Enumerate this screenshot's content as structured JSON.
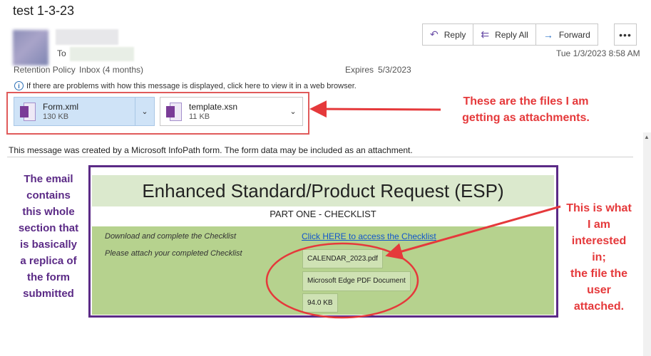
{
  "email": {
    "subject": "test 1-3-23",
    "to_label": "To",
    "retention_policy_label": "Retention Policy",
    "retention_value": "Inbox (4 months)",
    "expires_label": "Expires",
    "expires_value": "5/3/2023",
    "date": "Tue 1/3/2023 8:58 AM",
    "info_bar": "If there are problems with how this message is displayed, click here to view it in a web browser.",
    "infopath_message": "This message was created by a Microsoft InfoPath form. The form data may be included as an attachment."
  },
  "actions": {
    "reply": "Reply",
    "reply_all": "Reply All",
    "forward": "Forward",
    "more": "•••"
  },
  "attachments": [
    {
      "name": "Form.xml",
      "size": "130 KB"
    },
    {
      "name": "template.xsn",
      "size": "11 KB"
    }
  ],
  "form": {
    "title": "Enhanced Standard/Product Request (ESP)",
    "part": "PART ONE - CHECKLIST",
    "download_label": "Download and complete the Checklist",
    "link_text": "Click HERE to access the Checklist",
    "attach_label": "Please attach your completed Checklist",
    "file_name": "CALENDAR_2023.pdf",
    "file_type": "Microsoft Edge PDF Document",
    "file_size": "94.0 KB"
  },
  "annotations": {
    "files_line1": "These are the files I am",
    "files_line2": "getting as attachments.",
    "interest_lines": [
      "This is what",
      "I am",
      "interested",
      "in;",
      "the file the",
      "user",
      "attached."
    ],
    "email_lines": [
      "The email",
      "contains",
      "this whole",
      "section that",
      "is basically",
      "a replica of",
      "the form",
      "submitted"
    ]
  },
  "colors": {
    "annotation_red": "#e5393b",
    "annotation_purple": "#5b2a86",
    "form_green": "#b6d28e",
    "title_green": "#dbe9cd",
    "selected_attachment": "#cfe3f7"
  }
}
